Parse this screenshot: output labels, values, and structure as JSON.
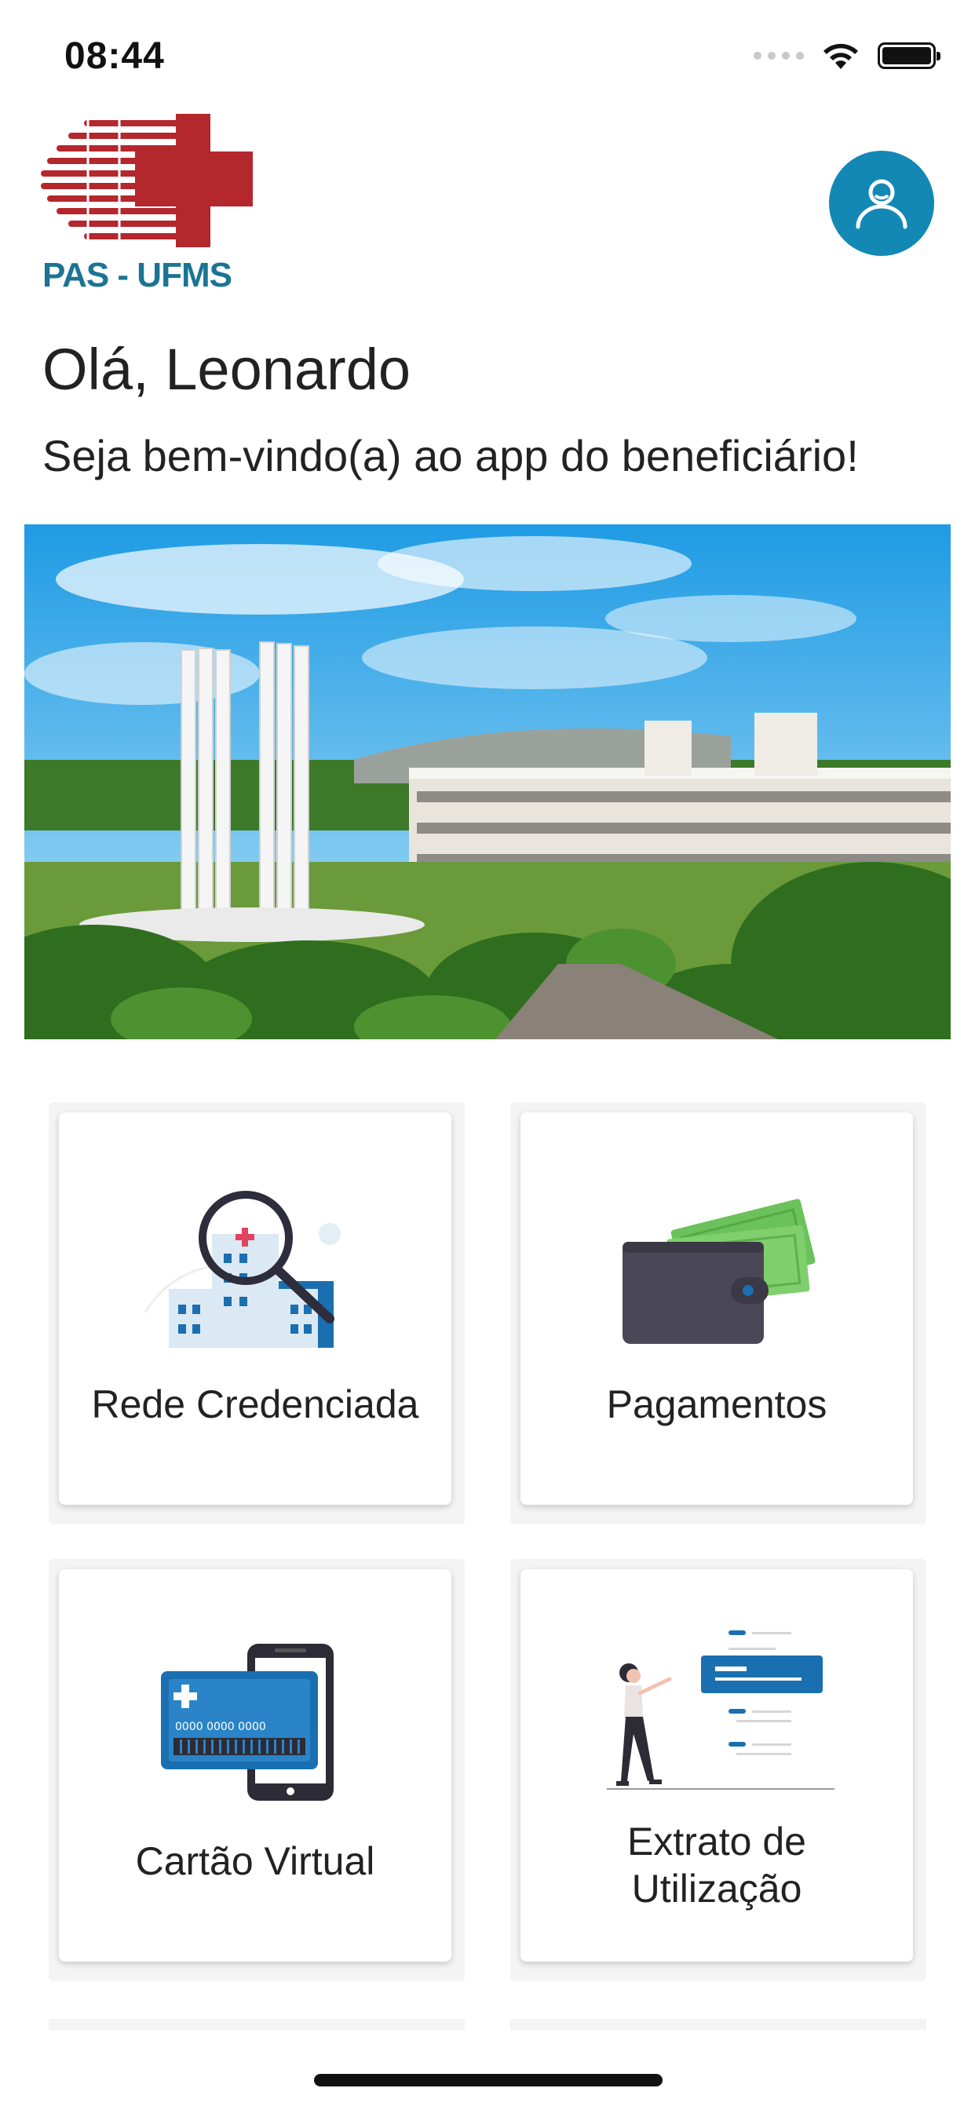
{
  "status_bar": {
    "time": "08:44"
  },
  "header": {
    "logo_text": "PAS - UFMS",
    "profile_icon": "user-icon"
  },
  "greeting": "Olá, Leonardo",
  "subtitle": "Seja bem-vindo(a) ao app do beneficiário!",
  "banner": {
    "description_icon": "campus-photo"
  },
  "cards": [
    {
      "label": "Rede Credenciada",
      "icon": "hospital-search-icon"
    },
    {
      "label": "Pagamentos",
      "icon": "wallet-icon"
    },
    {
      "label": "Cartão Virtual",
      "icon": "card-phone-icon",
      "card_number": "0000 0000 0000"
    },
    {
      "label_line1": "Extrato de",
      "label_line2": "Utilização",
      "icon": "statement-icon"
    }
  ],
  "colors": {
    "brand_blue": "#1488b5",
    "logo_red": "#b3272d",
    "logo_text_blue": "#1b7494"
  }
}
